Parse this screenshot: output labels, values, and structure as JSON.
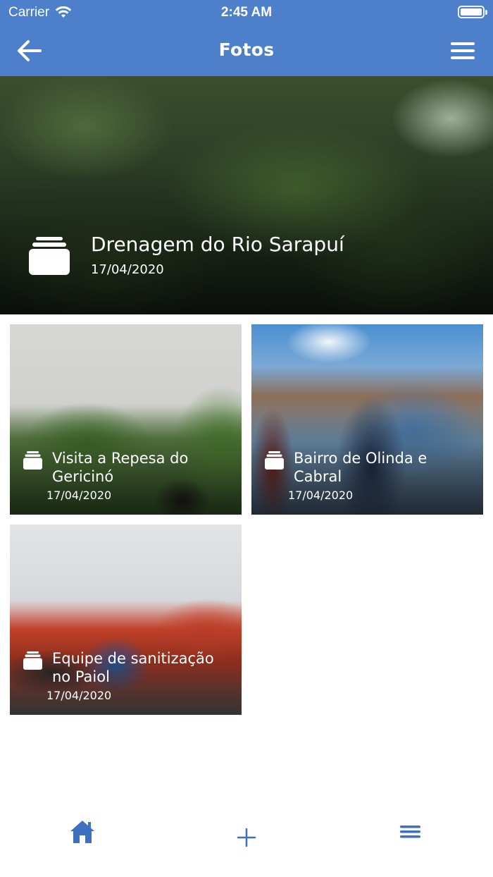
{
  "status_bar": {
    "carrier": "Carrier",
    "time": "2:45 AM"
  },
  "nav": {
    "title": "Fotos",
    "back_icon": "arrow-left-icon",
    "menu_icon": "hamburger-menu-icon"
  },
  "featured_album": {
    "title": "Drenagem do Rio Sarapuí",
    "date": "17/04/2020",
    "icon": "album-stack-icon"
  },
  "albums": [
    {
      "title": "Visita a Repesa do Gericinó",
      "date": "17/04/2020"
    },
    {
      "title": "Bairro de Olinda e Cabral",
      "date": "17/04/2020"
    },
    {
      "title": "Equipe de sanitização no Paiol",
      "date": "17/04/2020"
    }
  ],
  "tab_bar": {
    "items": [
      "home-icon",
      "plus-icon",
      "menu-icon"
    ]
  },
  "colors": {
    "primary": "#4d7fcb",
    "tab_icon": "#3f6fc0",
    "background": "#ffffff"
  }
}
